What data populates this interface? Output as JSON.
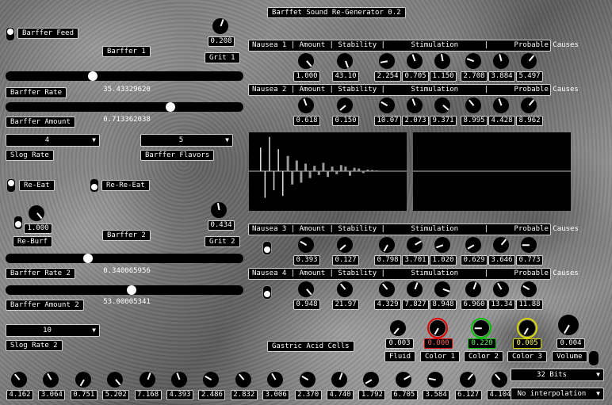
{
  "app": {
    "title": "Barffet Sound Re-Generator 0.2"
  },
  "left": {
    "feed_label": "Barffer Feed",
    "barffer1_label": "Barffer 1",
    "grit1": {
      "value": "0.208",
      "label": "Grit 1",
      "angle": 20
    },
    "rate": {
      "label": "Barffer Rate",
      "value": "35.43329620",
      "fraction": 0.36
    },
    "amount": {
      "label": "Barffer Amount",
      "value": "0.713362038",
      "fraction": 0.7
    },
    "slog_rate": {
      "value": "4",
      "label": "Slog Rate"
    },
    "flavors": {
      "value": "5",
      "label": "Barffer Flavors"
    },
    "reeat_label": "Re-Eat",
    "rereeat_label": "Re-Re-Eat",
    "reburf": {
      "value": "1.000",
      "label": "Re-Burf",
      "angle": 140
    },
    "barffer2_label": "Barffer 2",
    "grit2": {
      "value": "0.434",
      "label": "Grit 2",
      "angle": -10
    },
    "rate2": {
      "label": "Barffer Rate 2",
      "value": "0.340065956",
      "fraction": 0.34
    },
    "amount2": {
      "label": "Barffer Amount 2",
      "value": "53.00005341",
      "fraction": 0.53
    },
    "slog_rate2": {
      "value": "10",
      "label": "Slog Rate 2"
    },
    "gastric_label": "Gastric Acid Cells"
  },
  "nausea": [
    {
      "header": "Nausea 1 | Amount | Stability |      Stimulation      |      Probable Causes",
      "values": [
        "1.000",
        "43.10",
        "2.254",
        "0.705",
        "1.150",
        "2.708",
        "3.884",
        "5.497"
      ],
      "angles": [
        140,
        160,
        -100,
        -20,
        -10,
        -70,
        -15,
        40
      ]
    },
    {
      "header": "Nausea 2 | Amount | Stability |      Stimulation      |      Probable Causes",
      "values": [
        "0.618",
        "0.150",
        "10.07",
        "2.073",
        "9.371",
        "8.995",
        "4.428",
        "8.962"
      ],
      "angles": [
        -20,
        -130,
        -60,
        -20,
        130,
        -40,
        -20,
        40
      ]
    },
    {
      "header": "Nausea 3 | Amount | Stability |      Stimulation      |      Probable Causes",
      "values": [
        "0.393",
        "0.127",
        "0.798",
        "3.701",
        "1.020",
        "0.629",
        "3.646",
        "0.773"
      ],
      "angles": [
        -60,
        -130,
        -150,
        60,
        -110,
        -120,
        40,
        -90
      ]
    },
    {
      "header": "Nausea 4 | Amount | Stability |      Stimulation      |      Probable Causes",
      "values": [
        "0.948",
        "21.97",
        "4.329",
        "7.827",
        "8.948",
        "6.960",
        "13.34",
        "11.88"
      ],
      "angles": [
        140,
        -40,
        -40,
        20,
        110,
        20,
        -30,
        -60
      ]
    }
  ],
  "fx": {
    "fluid": {
      "value": "0.003",
      "label": "Fluid",
      "angle": -140
    },
    "color1": {
      "value": "0.000",
      "label": "Color 1",
      "angle": -150,
      "color": "#e00000"
    },
    "color2": {
      "value": "0.220",
      "label": "Color 2",
      "angle": -90,
      "color": "#00c000"
    },
    "color3": {
      "value": "0.005",
      "label": "Color 3",
      "angle": -150,
      "color": "#d8d800"
    },
    "volume": {
      "value": "0.004",
      "label": "Volume",
      "angle": -150
    }
  },
  "bottom_knobs": {
    "values": [
      "4.162",
      "3.064",
      "0.751",
      "5.202",
      "7.168",
      "4.393",
      "2.486",
      "2.832",
      "3.006",
      "2.370",
      "4.740",
      "1.792",
      "6.705",
      "3.584",
      "6.127",
      "4.104"
    ],
    "angles": [
      -40,
      -30,
      -150,
      140,
      20,
      -20,
      -60,
      -40,
      -30,
      -60,
      20,
      -120,
      60,
      -80,
      40,
      -40
    ]
  },
  "bits": {
    "value": "32 Bits"
  },
  "interp": {
    "value": "No interpolation"
  },
  "scope": {
    "bars": [
      0.62,
      -0.7,
      0.9,
      -0.5,
      0.58,
      -0.65,
      0.4,
      -0.35,
      0.28,
      -0.3,
      0.2,
      -0.18,
      0.14,
      -0.1,
      0.22,
      -0.15,
      0.12,
      -0.08,
      0.16,
      0.12,
      -0.12,
      0.09,
      0.07,
      -0.05,
      0.04,
      0.03,
      0.02
    ]
  }
}
